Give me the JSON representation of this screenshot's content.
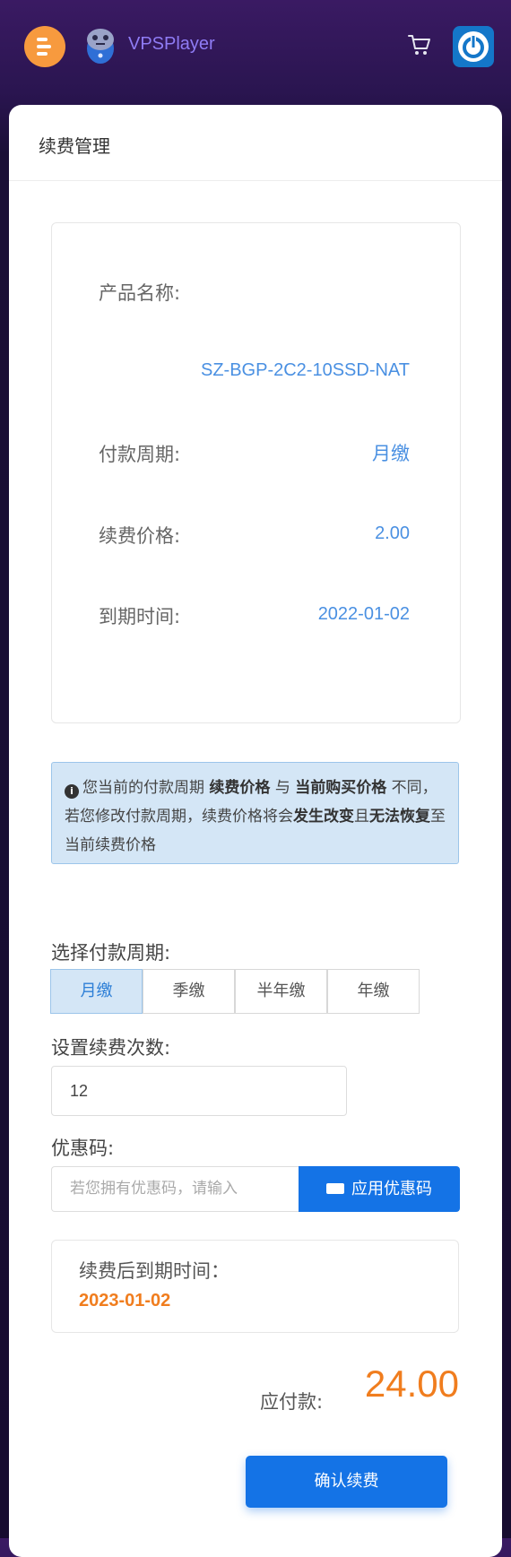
{
  "header": {
    "brand": "VPSPlayer",
    "menu_icon": "menu-icon",
    "cart_icon": "cart-icon",
    "power_icon": "power-icon"
  },
  "page": {
    "title": "续费管理"
  },
  "product": {
    "name_label": "产品名称:",
    "name_value": "SZ-BGP-2C2-10SSD-NAT",
    "period_label": "付款周期:",
    "period_value": "月缴",
    "price_label": "续费价格:",
    "price_value": "2.00",
    "expire_label": "到期时间:",
    "expire_value": "2022-01-02"
  },
  "alert": {
    "part1": "您当前的付款周期",
    "bold1": "续费价格",
    "part2": "与",
    "bold2": "当前购买价格",
    "part3": "不同，若您修改付款周期，续费价格将会",
    "bold3": "发生改变",
    "part4": "且",
    "bold4": "无法恢复",
    "part5": "至当前续费价格"
  },
  "form": {
    "period_select_label": "选择付款周期:",
    "periods": [
      "月缴",
      "季缴",
      "半年缴",
      "年缴"
    ],
    "selected_period": "月缴",
    "count_label": "设置续费次数:",
    "count_value": "12",
    "coupon_label": "优惠码:",
    "coupon_placeholder": "若您拥有优惠码，请输入",
    "coupon_button": "应用优惠码",
    "new_expire_label": "续费后到期时间：",
    "new_expire_value": "2023-01-02",
    "pay_label": "应付款:",
    "pay_value": "24.00",
    "confirm_button": "确认续费"
  },
  "colors": {
    "accent": "#1473e6",
    "orange": "#f07d1e",
    "link_blue": "#4a90e2"
  }
}
